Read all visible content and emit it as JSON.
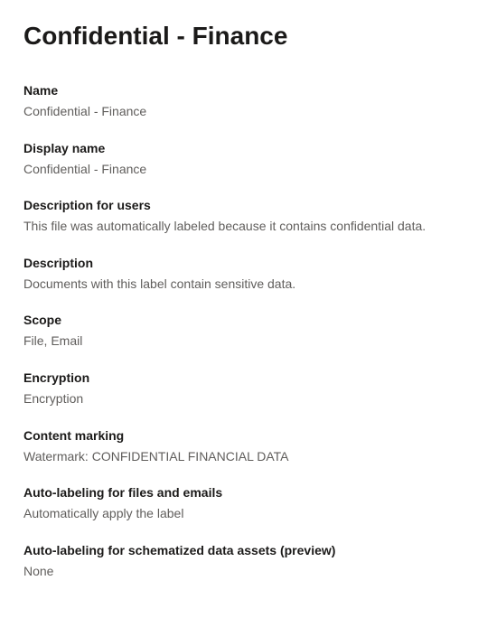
{
  "header": {
    "title": "Confidential - Finance"
  },
  "fields": {
    "name": {
      "label": "Name",
      "value": "Confidential - Finance"
    },
    "displayName": {
      "label": "Display name",
      "value": "Confidential - Finance"
    },
    "descriptionForUsers": {
      "label": "Description for users",
      "value": "This file was automatically labeled because it contains confidential data."
    },
    "description": {
      "label": "Description",
      "value": "Documents with this label contain sensitive data."
    },
    "scope": {
      "label": "Scope",
      "value": "File, Email"
    },
    "encryption": {
      "label": "Encryption",
      "value": "Encryption"
    },
    "contentMarking": {
      "label": "Content marking",
      "value": "Watermark: CONFIDENTIAL FINANCIAL DATA"
    },
    "autoLabelingFiles": {
      "label": "Auto-labeling for files and emails",
      "value": "Automatically apply the label"
    },
    "autoLabelingSchematized": {
      "label": "Auto-labeling for schematized data assets (preview)",
      "value": "None"
    }
  }
}
